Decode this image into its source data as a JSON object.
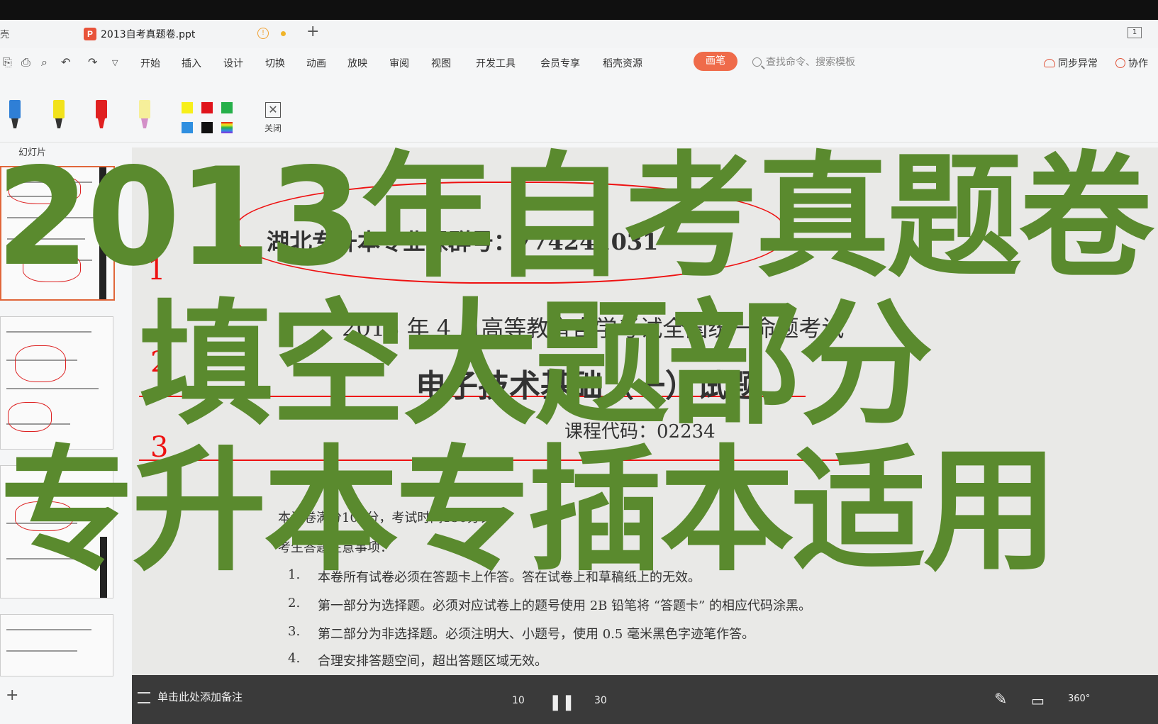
{
  "tab_row": {
    "left_text": "壳",
    "doc_title": "2013自考真题卷.ppt",
    "warn": "!",
    "plus": "+",
    "window_btn": "1"
  },
  "menu": {
    "items": [
      "开始",
      "插入",
      "设计",
      "切换",
      "动画",
      "放映",
      "审阅",
      "视图",
      "开发工具",
      "会员专享",
      "稻壳资源"
    ],
    "active": "画笔",
    "search_placeholder": "查找命令、搜索模板",
    "sync": "同步异常",
    "collab": "协作"
  },
  "pen_toolbar": {
    "pens": [
      "#2f7fd6",
      "#f2e21b",
      "#e02020",
      "#f6ef9a"
    ],
    "swatches": [
      "#f7ef1a",
      "#e0141c",
      "#26b04a",
      "#2f8fe0",
      "#111111",
      "rainbow"
    ],
    "close_label": "关闭",
    "close_glyph": "✕"
  },
  "slides_panel": {
    "label": "幻灯片",
    "add": "+"
  },
  "slide": {
    "header_handwritten": "湖北专升本专业课群号：774241031",
    "exam_title": "2013 年 4 月高等教育自学考试全国统一命题考试",
    "subject": "电子技术基础（一）试题",
    "code": "课程代码：02234",
    "instructions_intro": "本试卷满分100分，考试时间150分钟。",
    "notes_heading": "考生答题注意事项：",
    "notes": [
      {
        "num": "1.",
        "text": "本卷所有试卷必须在答题卡上作答。答在试卷上和草稿纸上的无效。"
      },
      {
        "num": "2.",
        "text": "第一部分为选择题。必须对应试卷上的题号使用 2B 铅笔将 “答题卡” 的相应代码涂黑。"
      },
      {
        "num": "3.",
        "text": "第二部分为非选择题。必须注明大、小题号，使用 0.5 毫米黑色字迹笔作答。"
      },
      {
        "num": "4.",
        "text": "合理安排答题空间，超出答题区域无效。"
      }
    ],
    "hand_nums": [
      "1",
      "2",
      "3"
    ]
  },
  "overlay": {
    "line1": "2013年自考真题卷",
    "line2": "填空大题部分",
    "line3": "专升本专插本适用",
    "color": "#5a8a2e"
  },
  "notes_bar": {
    "placeholder": "单击此处添加备注",
    "rewind": "10",
    "forward": "30",
    "pause": "❚❚",
    "vr": "360°"
  }
}
